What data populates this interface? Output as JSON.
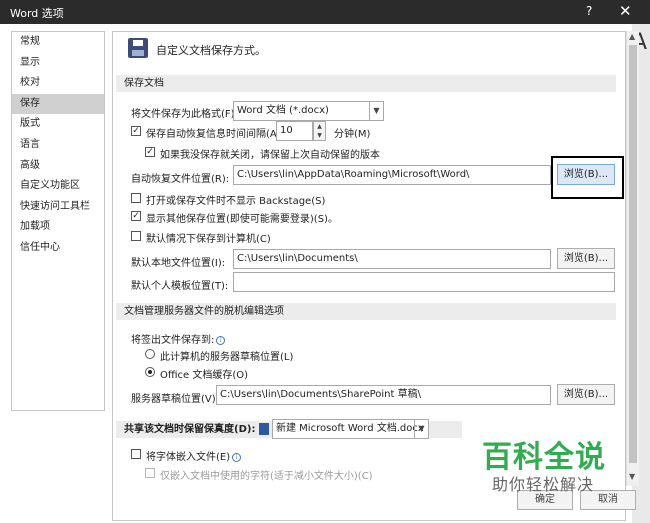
{
  "window": {
    "title": "Word 选项",
    "help": "?",
    "close": "✕"
  },
  "sidebar": {
    "items": [
      {
        "label": "常规"
      },
      {
        "label": "显示"
      },
      {
        "label": "校对"
      },
      {
        "label": "保存"
      },
      {
        "label": "版式"
      },
      {
        "label": "语言"
      },
      {
        "label": "高级"
      },
      {
        "label": "自定义功能区"
      },
      {
        "label": "快速访问工具栏"
      },
      {
        "label": "加载项"
      },
      {
        "label": "信任中心"
      }
    ],
    "active_index": 3
  },
  "header": {
    "text": "自定义文档保存方式。"
  },
  "save_section": {
    "title": "保存文档",
    "format_label": "将文件保存为此格式(F):",
    "format_value": "Word 文档 (*.docx)",
    "autorecover_label": "保存自动恢复信息时间间隔(A)",
    "autorecover_checked": true,
    "autorecover_minutes": "10",
    "minutes_unit": "分钟(M)",
    "keep_last_label": "如果我没保存就关闭，请保留上次自动保留的版本",
    "keep_last_checked": true,
    "autorecover_location_label": "自动恢复文件位置(R):",
    "autorecover_location_value": "C:\\Users\\lin\\AppData\\Roaming\\Microsoft\\Word\\",
    "browse_label": "浏览(B)...",
    "backstage_label": "打开或保存文件时不显示 Backstage(S)",
    "backstage_checked": false,
    "show_other_label": "显示其他保存位置(即使可能需要登录)(S)。",
    "show_other_checked": true,
    "default_computer_label": "默认情况下保存到计算机(C)",
    "default_computer_checked": false,
    "local_location_label": "默认本地文件位置(I):",
    "local_location_value": "C:\\Users\\lin\\Documents\\",
    "local_browse_label": "浏览(B)...",
    "template_location_label": "默认个人模板位置(T):",
    "template_location_value": ""
  },
  "offline_section": {
    "title": "文档管理服务器文件的脱机编辑选项",
    "checkout_label": "将签出文件保存到:",
    "option_server": "此计算机的服务器草稿位置(L)",
    "option_cache": "Office 文档缓存(O)",
    "selected": "cache",
    "drafts_label": "服务器草稿位置(V):",
    "drafts_value": "C:\\Users\\lin\\Documents\\SharePoint 草稿\\",
    "drafts_browse_label": "浏览(B)..."
  },
  "fidelity_section": {
    "title": "共享该文档时保留保真度(D):",
    "doc_value": "新建 Microsoft Word 文档.docx",
    "embed_fonts_label": "将字体嵌入文件(E)",
    "embed_fonts_checked": false,
    "embed_used_label": "仅嵌入文档中使用的字符(适于减小文件大小)(C)"
  },
  "footer": {
    "ok_label": "确定",
    "cancel_label": "取消"
  },
  "watermark": {
    "title": "百科全说",
    "subtitle": "助你轻松解决"
  },
  "background": {
    "glyph": "A"
  },
  "colors": {
    "titlebar": "#2b2b2b",
    "section": "#ececec",
    "watermark": "#2eae4f",
    "highlight_button": "#dde8f6"
  }
}
